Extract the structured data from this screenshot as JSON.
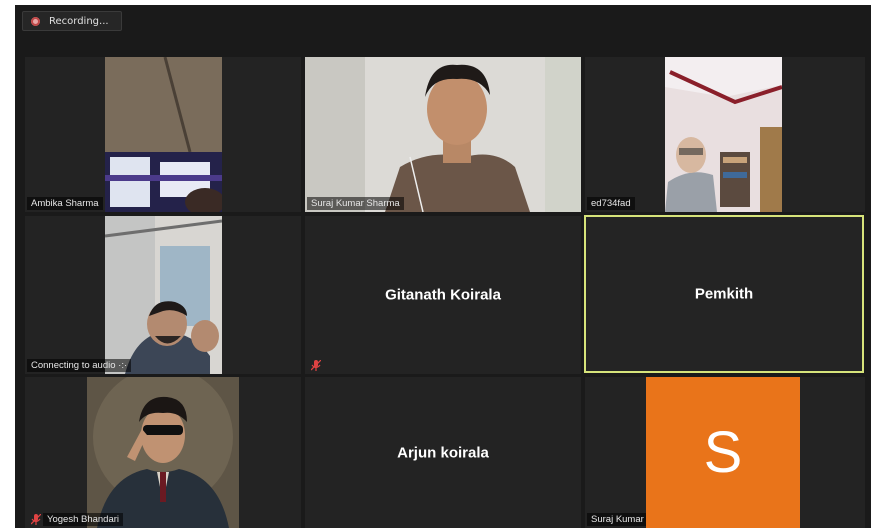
{
  "recording": {
    "label": "Recording..."
  },
  "participants": [
    {
      "name": "Ambika Sharma",
      "has_video": true
    },
    {
      "name": "Suraj Kumar Sharma",
      "has_video": true
    },
    {
      "name": "ed734fad",
      "has_video": true
    },
    {
      "name": "Connecting to audio",
      "status_dots": "·:·",
      "has_video": true
    },
    {
      "name": "Gitanath Koirala",
      "muted": true,
      "has_video": false
    },
    {
      "name": "Pemkith",
      "active_speaker": true,
      "has_video": false
    },
    {
      "name": "Yogesh Bhandari",
      "muted": true,
      "has_video": true
    },
    {
      "name": "Arjun koirala",
      "has_video": false
    },
    {
      "name": "Suraj Kumar Sharma",
      "avatar_letter": "S",
      "avatar_color": "#e9741a",
      "has_video": false
    }
  ],
  "colors": {
    "active_border": "#d6e37a",
    "mute_icon": "#e04343",
    "recording_dot": "#c04848"
  }
}
